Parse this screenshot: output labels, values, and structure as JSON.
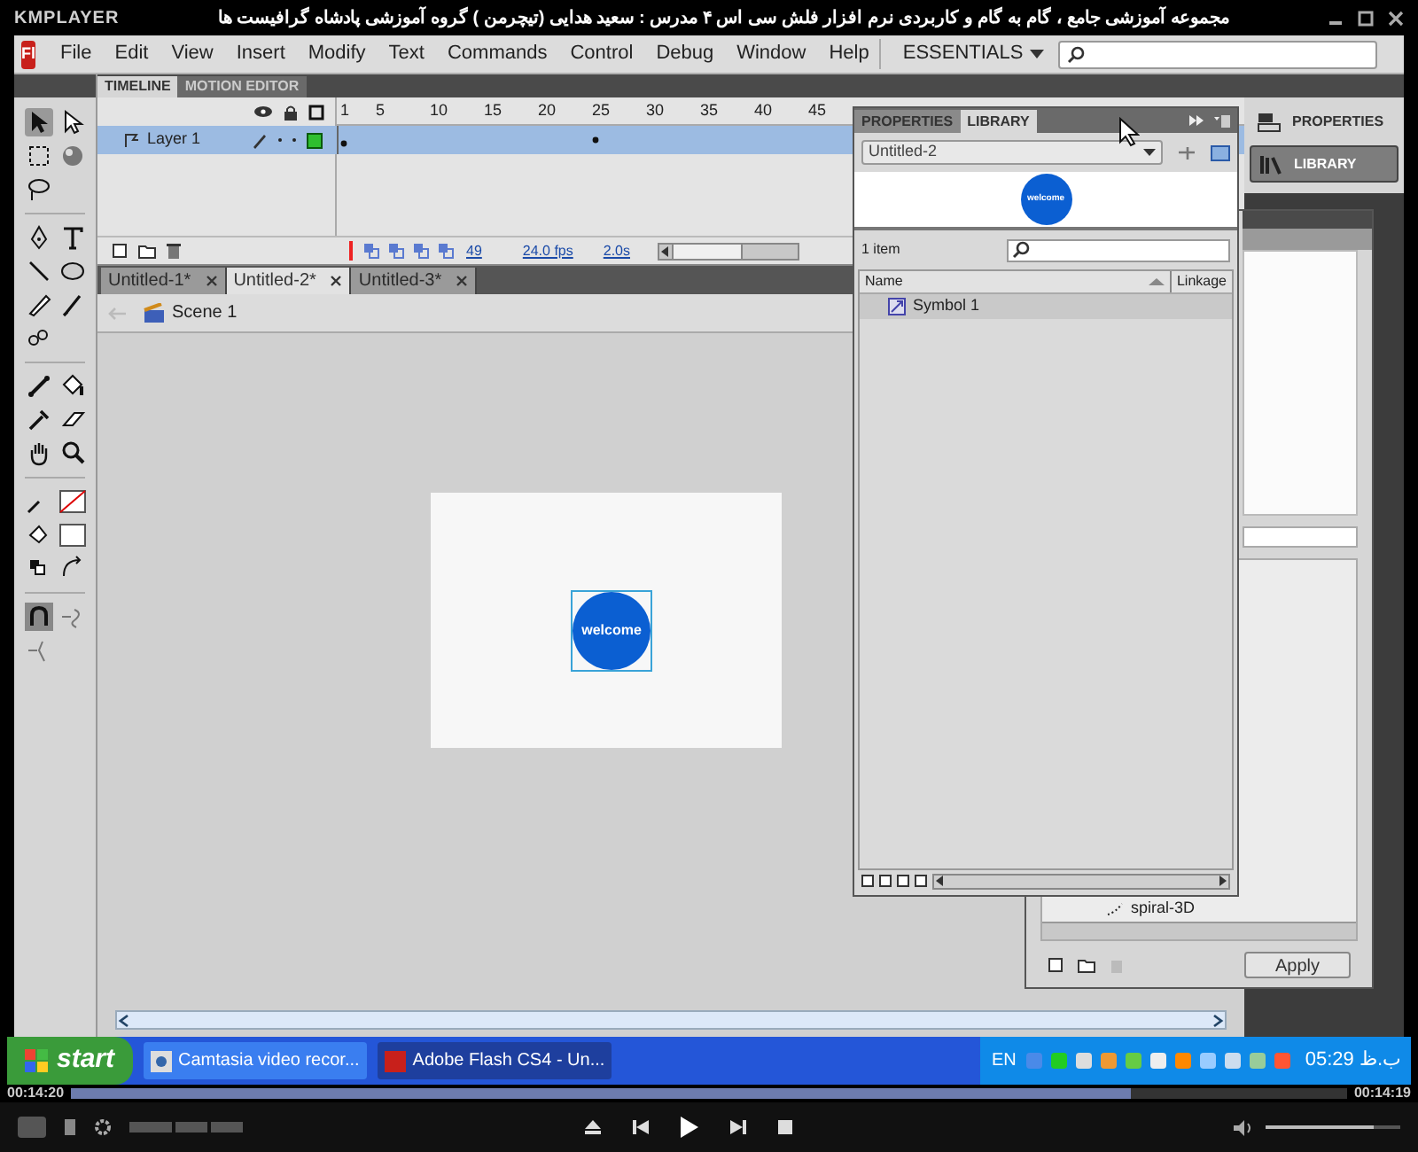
{
  "player": {
    "logo": "KMPLAYER",
    "title": "مجموعه آموزشی جامع ، گام به گام و کاربردی نرم افزار فلش سی اس ۴ مدرس : سعید هدایی (تیچرمن ) گروه آموزشی پادشاه گرافیست ها",
    "time_elapsed": "00:14:20",
    "time_total": "00:14:19",
    "progress": {
      "level": 0.83
    },
    "volume": {
      "level": 0.8
    }
  },
  "app_logo": "Fl",
  "menu": [
    "File",
    "Edit",
    "View",
    "Insert",
    "Modify",
    "Text",
    "Commands",
    "Control",
    "Debug",
    "Window",
    "Help"
  ],
  "workspace": "ESSENTIALS",
  "timeline": {
    "tabs": [
      {
        "label": "TIMELINE",
        "selected": true
      },
      {
        "label": "MOTION EDITOR",
        "selected": false
      }
    ],
    "frame_numbers": [
      "1",
      "5",
      "10",
      "15",
      "20",
      "25",
      "30",
      "35",
      "40",
      "45"
    ],
    "layers": [
      {
        "name": "Layer 1",
        "selected": true
      }
    ],
    "current_frame": "49",
    "frame_rate": "24.0 fps",
    "elapsed": "2.0s"
  },
  "documents": [
    {
      "label": "Untitled-1*",
      "selected": false
    },
    {
      "label": "Untitled-2*",
      "selected": true
    },
    {
      "label": "Untitled-3*",
      "selected": false
    }
  ],
  "scene": "Scene 1",
  "stage": {
    "symbol_text": "welcome"
  },
  "library": {
    "tabs": [
      {
        "label": "PROPERTIES",
        "selected": false
      },
      {
        "label": "LIBRARY",
        "selected": true
      }
    ],
    "document": "Untitled-2",
    "preview_text": "welcome",
    "count": "1 item",
    "columns": [
      "Name",
      "Linkage"
    ],
    "items": [
      {
        "name": "Symbol 1",
        "selected": true
      }
    ]
  },
  "dock": [
    {
      "label": "PROPERTIES",
      "selected": false
    },
    {
      "label": "LIBRARY",
      "selected": true
    }
  ],
  "presets": {
    "items": [
      {
        "name": "spiral-3D"
      }
    ],
    "apply": "Apply"
  },
  "taskbar": {
    "start": "start",
    "windows": [
      {
        "label": "Camtasia video recor...",
        "selected": false
      },
      {
        "label": "Adobe Flash CS4 - Un...",
        "selected": true
      }
    ],
    "language": "EN",
    "clock": "05:29 ب.ظ"
  }
}
